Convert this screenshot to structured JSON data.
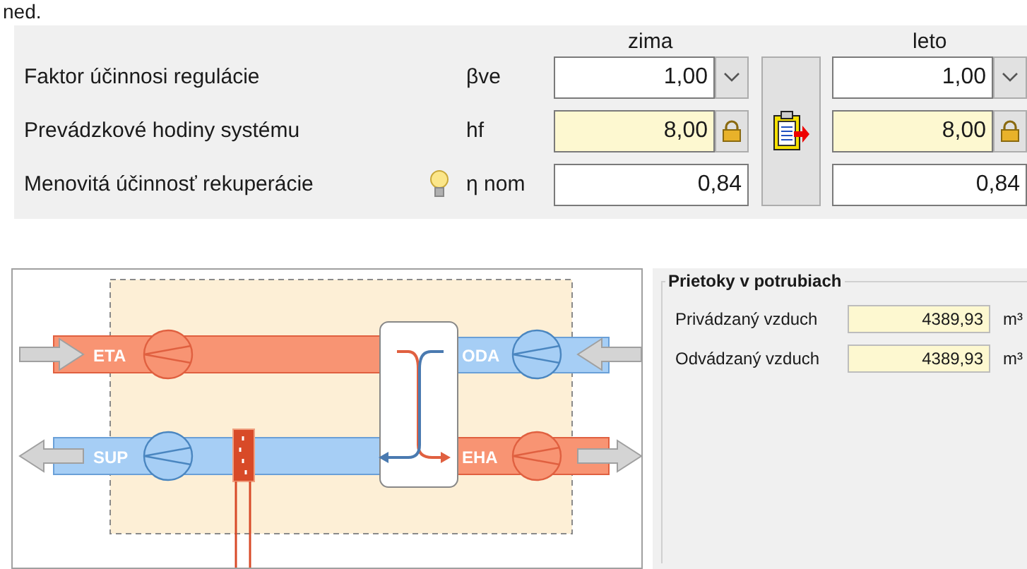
{
  "top_fragment": "ned.",
  "columns": [
    "zima",
    "leto"
  ],
  "rows": [
    {
      "label": "Faktor účinnosi regulácie",
      "symbol": "βve",
      "hint": false,
      "kind": "dropdown",
      "winter": "1,00",
      "summer": "1,00",
      "locked": false
    },
    {
      "label": "Prevádzkové hodiny systému",
      "symbol": "hf",
      "hint": false,
      "kind": "locked",
      "winter": "8,00",
      "summer": "8,00",
      "locked": true
    },
    {
      "label": "Menovitá účinnosť rekuperácie",
      "symbol": "η nom",
      "hint": true,
      "kind": "plain",
      "winter": "0,84",
      "summer": "0,84",
      "locked": false
    }
  ],
  "diagram": {
    "labels": [
      "ETA",
      "ODA",
      "SUP",
      "EHA"
    ]
  },
  "flows": {
    "title": "Prietoky v potrubiach",
    "rows": [
      {
        "label": "Privádzaný vzduch",
        "value": "4389,93",
        "unit": "m³"
      },
      {
        "label": "Odvádzaný vzduch",
        "value": "4389,93",
        "unit": "m³"
      }
    ]
  }
}
